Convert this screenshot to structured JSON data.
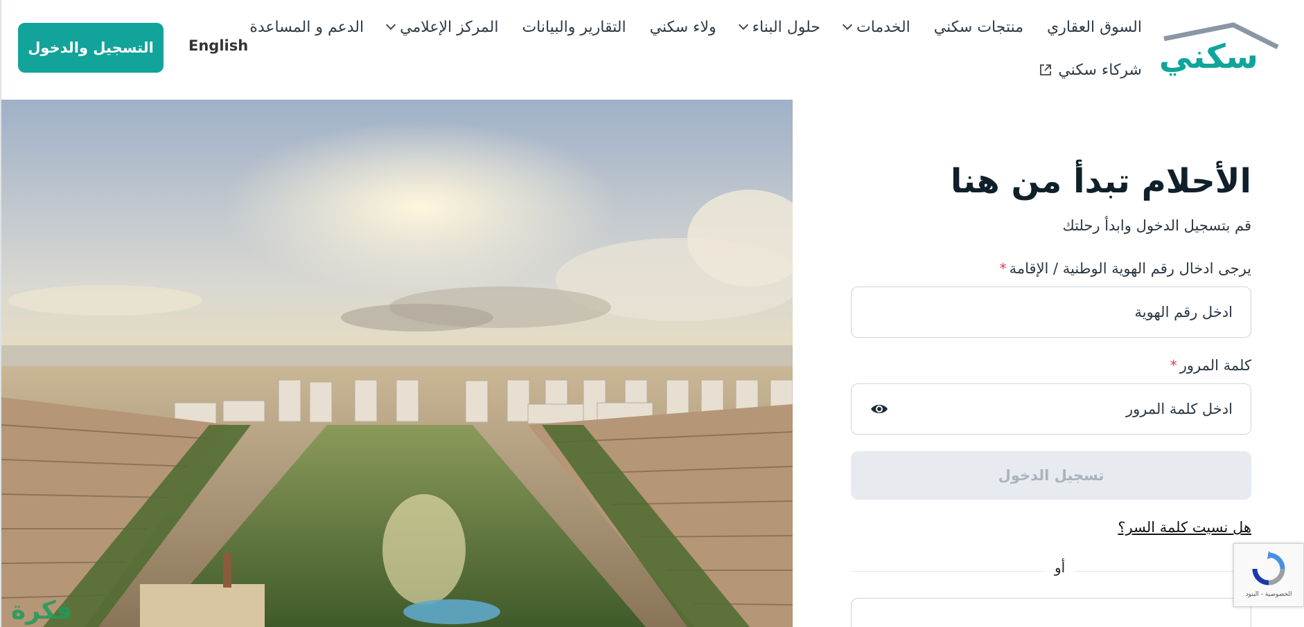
{
  "header": {
    "logo_text": "سكني",
    "nav_row1": [
      {
        "label": "السوق العقاري",
        "dropdown": false
      },
      {
        "label": "منتجات سكني",
        "dropdown": false
      },
      {
        "label": "الخدمات",
        "dropdown": true
      },
      {
        "label": "حلول البناء",
        "dropdown": true
      },
      {
        "label": "ولاء سكني",
        "dropdown": false
      },
      {
        "label": "التقارير والبيانات",
        "dropdown": false
      },
      {
        "label": "المركز الإعلامي",
        "dropdown": true
      },
      {
        "label": "الدعم و المساعدة",
        "dropdown": false
      }
    ],
    "nav_row2": [
      {
        "label": "شركاء سكني",
        "external": true
      }
    ],
    "language_label": "English",
    "login_button_label": "التسجيل والدخول"
  },
  "hero": {
    "image_name": "aerial-city-development-render"
  },
  "login": {
    "title": "الأحلام تبدأ من هنا",
    "subtitle": "قم بتسجيل الدخول وابدأ رحلتك",
    "id_label": "يرجى ادخال رقم الهوية الوطنية / الإقامة",
    "id_placeholder": "ادخل رقم الهوية",
    "password_label": "كلمة المرور",
    "password_placeholder": "ادخل كلمة المرور",
    "required_mark": "*",
    "submit_label": "تسجيل الدخول",
    "forgot_label": "هل نسيت كلمة السر؟",
    "or_label": "أو"
  },
  "recaptcha": {
    "label": "الخصوصية - البنود"
  },
  "watermark": {
    "text": "فكرة"
  },
  "colors": {
    "brand": "#12a39a",
    "button_disabled": "#e7eaee",
    "required": "#e0393e"
  }
}
